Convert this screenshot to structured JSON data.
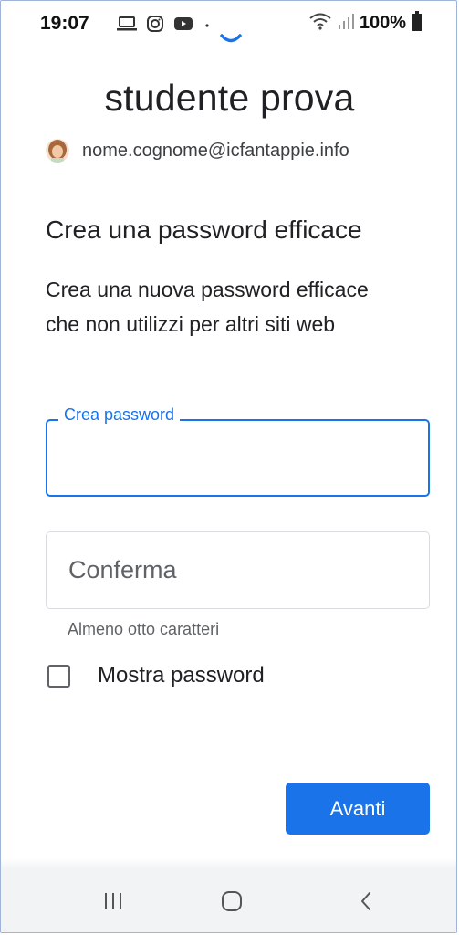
{
  "status_bar": {
    "time": "19:07",
    "battery": "100%",
    "icons": [
      "laptop-icon",
      "instagram-icon",
      "youtube-icon",
      "dot-icon",
      "wifi-icon",
      "signal-icon",
      "battery-icon"
    ]
  },
  "account": {
    "name": "studente prova",
    "email": "nome.cognome@icfantappie.info"
  },
  "form": {
    "heading": "Crea una password efficace",
    "description": "Crea una nuova password efficace che non utilizzi per altri siti web",
    "password_label": "Crea password",
    "password_value": "",
    "confirm_placeholder": "Conferma",
    "confirm_value": "",
    "hint": "Almeno otto caratteri",
    "show_password_label": "Mostra password",
    "show_password_checked": false,
    "next_label": "Avanti"
  },
  "nav_bar": {
    "buttons": [
      "recent-apps-icon",
      "home-icon",
      "back-icon"
    ]
  },
  "colors": {
    "accent": "#1a73e8",
    "text": "#202124",
    "muted": "#5f6368",
    "nav_background": "#f1f3f4"
  }
}
